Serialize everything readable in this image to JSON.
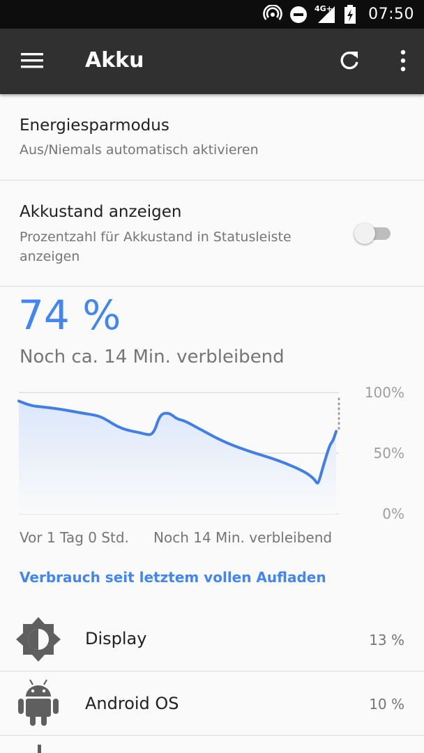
{
  "status_bar": {
    "time": "07:50",
    "network": "4G+"
  },
  "app_bar": {
    "title": "Akku"
  },
  "prefs": [
    {
      "title": "Energiesparmodus",
      "subtitle": "Aus/Niemals automatisch aktivieren"
    },
    {
      "title": "Akkustand anzeigen",
      "subtitle_line1": "Prozentzahl für Akkustand in Statusleiste",
      "subtitle_line2": "anzeigen",
      "toggle_on": false
    }
  ],
  "battery": {
    "level": "74 %",
    "remaining": "Noch ca. 14 Min. verbleibend"
  },
  "chart_data": {
    "type": "area",
    "y_tick_labels": [
      "100%",
      "50%",
      "0%"
    ],
    "ylim": [
      0,
      100
    ],
    "x_start_label": "Vor 1 Tag 0 Std.",
    "x_end_label": "Noch 14 Min. verbleibend",
    "x": [
      0,
      0.04,
      0.08,
      0.14,
      0.2,
      0.25,
      0.28,
      0.31,
      0.34,
      0.38,
      0.41,
      0.42,
      0.43,
      0.44,
      0.45,
      0.46,
      0.47,
      0.48,
      0.5,
      0.52,
      0.57,
      0.64,
      0.72,
      0.82,
      0.9,
      0.93,
      0.94,
      0.945,
      0.96,
      0.98,
      0.99,
      1.0
    ],
    "values": [
      93,
      89,
      88,
      86,
      83,
      81,
      77,
      72,
      69,
      67,
      65,
      66,
      70,
      78,
      82,
      83,
      83,
      82,
      78,
      77,
      70,
      60,
      52,
      44,
      35,
      29,
      25,
      26,
      40,
      57,
      60,
      68
    ],
    "projection_values": [
      68,
      95
    ],
    "colors": {
      "line": "#3f7fe6",
      "fill_top": "#dbe7fb",
      "fill_bottom": "#fafafa",
      "grid": "#d9d9d9"
    }
  },
  "usage_link": "Verbrauch seit letztem vollen Aufladen",
  "apps": [
    {
      "name": "Display",
      "percent": "13 %",
      "icon": "brightness-icon"
    },
    {
      "name": "Android OS",
      "percent": "10 %",
      "icon": "android-icon"
    }
  ]
}
